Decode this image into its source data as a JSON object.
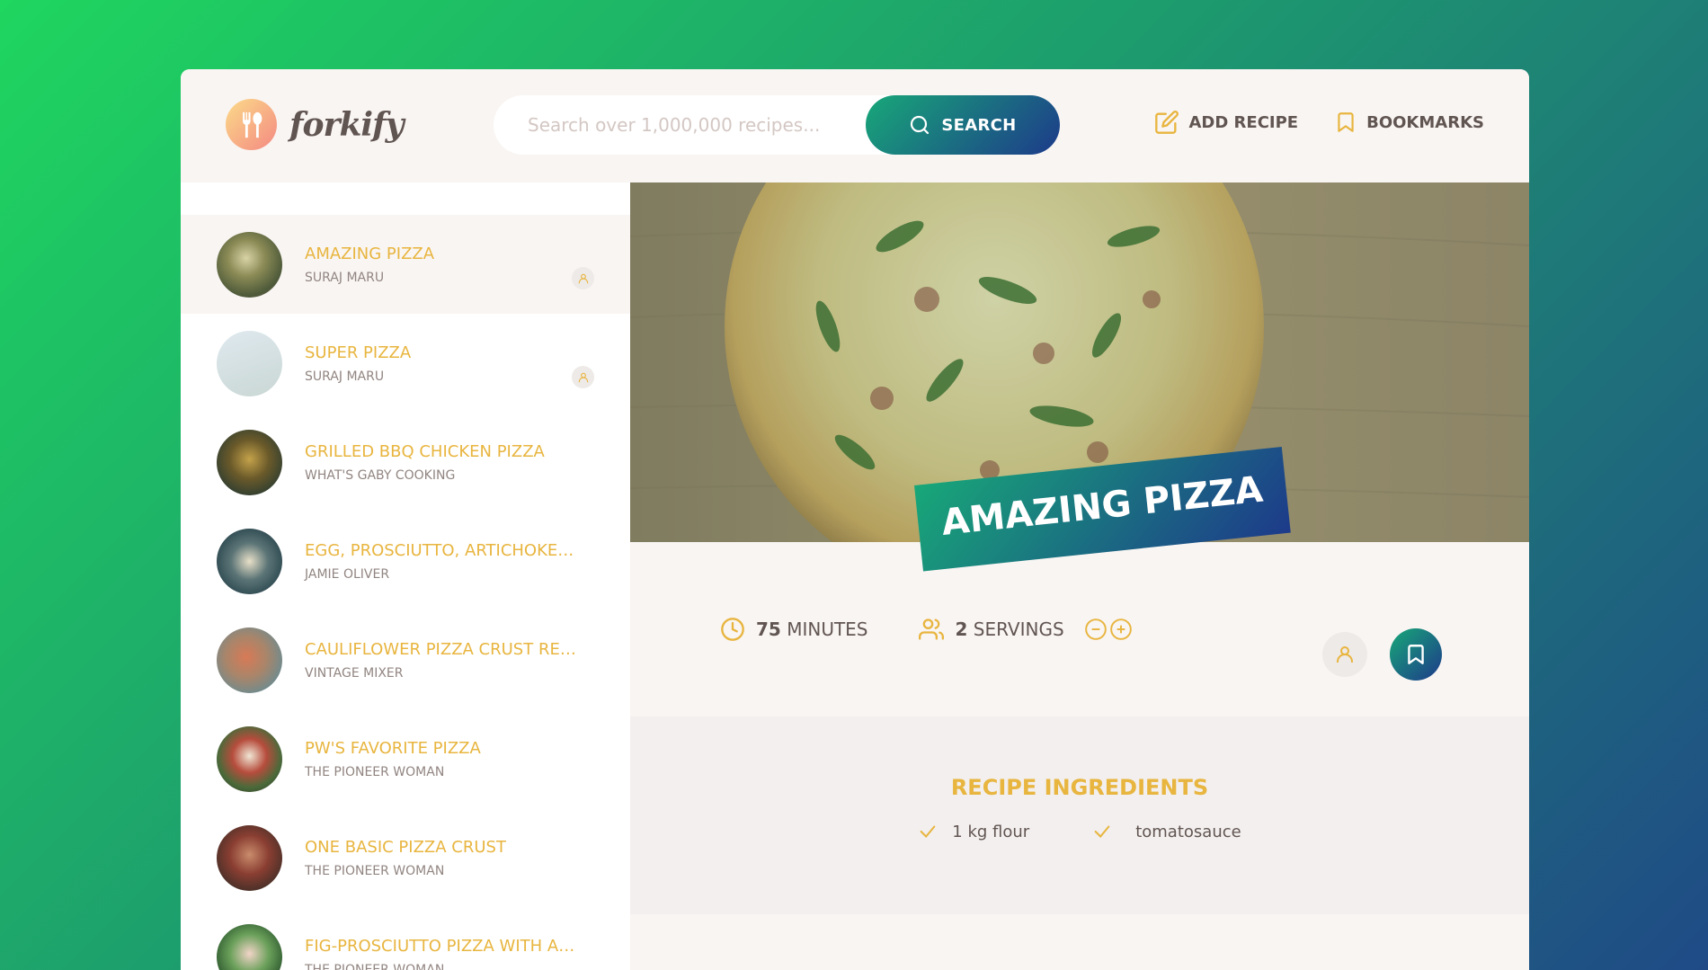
{
  "header": {
    "logo_text": "forkify",
    "search_placeholder": "Search over 1,000,000 recipes...",
    "search_button": "SEARCH",
    "nav": {
      "add_recipe": "ADD RECIPE",
      "bookmarks": "BOOKMARKS"
    }
  },
  "results": [
    {
      "title": "AMAZING PIZZA",
      "author": "SURAJ MARU",
      "user_generated": true,
      "active": true
    },
    {
      "title": "SUPER PIZZA",
      "author": "SURAJ MARU",
      "user_generated": true,
      "active": false
    },
    {
      "title": "GRILLED BBQ CHICKEN PIZZA",
      "author": "WHAT'S GABY COOKING",
      "user_generated": false
    },
    {
      "title": "EGG, PROSCIUTTO, ARTICHOKES, ...",
      "author": "JAMIE OLIVER",
      "user_generated": false
    },
    {
      "title": "CAULIFLOWER PIZZA CRUST RECI...",
      "author": "VINTAGE MIXER",
      "user_generated": false
    },
    {
      "title": "PW'S FAVORITE PIZZA",
      "author": "THE PIONEER WOMAN",
      "user_generated": false
    },
    {
      "title": "ONE BASIC PIZZA CRUST",
      "author": "THE PIONEER WOMAN",
      "user_generated": false
    },
    {
      "title": "FIG-PROSCIUTTO PIZZA WITH AR...",
      "author": "THE PIONEER WOMAN",
      "user_generated": false
    }
  ],
  "recipe": {
    "title": "AMAZING PIZZA",
    "minutes": "75",
    "minutes_label": "MINUTES",
    "servings": "2",
    "servings_label": "SERVINGS",
    "ingredients_heading": "RECIPE INGREDIENTS",
    "ingredients": [
      "1 kg flour",
      "tomatosauce"
    ]
  },
  "colors": {
    "accent": "#e8b53f",
    "gradient_start": "#18a878",
    "gradient_end": "#1d3a8a",
    "text": "#615551"
  }
}
